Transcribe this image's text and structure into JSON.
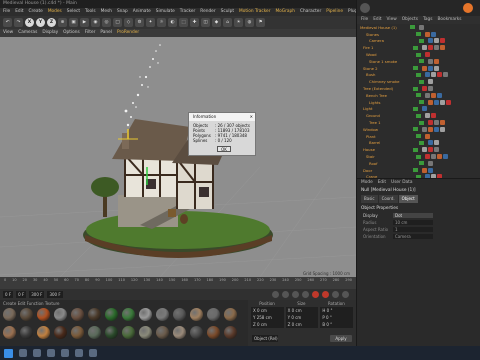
{
  "window": {
    "title": "Medieval House (1).c4d *) - Main"
  },
  "menubar": {
    "items": [
      "File",
      "Edit",
      "Create",
      "Modes",
      "Select",
      "Tools",
      "Mesh",
      "Snap",
      "Animate",
      "Simulate",
      "Tracker",
      "Render",
      "Sculpt",
      "Motion Tracker",
      "MoGraph",
      "Character",
      "Pipeline",
      "Plugins",
      "V-Ray Bridge",
      "Script",
      "Window",
      "Help"
    ],
    "highlighted": [
      "Modes",
      "Motion Tracker",
      "MoGraph",
      "Pipeline",
      "V-Ray Bridge",
      "Window"
    ]
  },
  "toolbar": {
    "buttons": [
      "↶",
      "↷",
      "X",
      "Y",
      "Z",
      "⊕",
      "▣",
      "▶",
      "◉",
      "◎",
      "□",
      "◇",
      "⚙",
      "✦",
      "☼",
      "◐",
      "⬚",
      "✚",
      "◫",
      "◆",
      "⌂",
      "☀",
      "◍",
      "⚑"
    ]
  },
  "viewport": {
    "menu": [
      "View",
      "Cameras",
      "Display",
      "Options",
      "Filter",
      "Panel",
      "ProRender"
    ],
    "selected_item": "ProRender",
    "status": "Grid Spacing : 1000 cm"
  },
  "info_dialog": {
    "title": "Information",
    "rows": [
      {
        "k": "Objects",
        "v": "26 / 307 objects"
      },
      {
        "k": "Points",
        "v": "11893 / 178103"
      },
      {
        "k": "Polygons",
        "v": "9741 / 180348"
      },
      {
        "k": "Splines",
        "v": "0 / 120"
      }
    ],
    "ok_label": "OK"
  },
  "timeline": {
    "ticks": [
      "0",
      "10",
      "20",
      "30",
      "40",
      "50",
      "60",
      "70",
      "80",
      "90",
      "100",
      "110",
      "120",
      "130",
      "140",
      "150",
      "160",
      "170",
      "180",
      "190",
      "200",
      "210",
      "220",
      "230",
      "240",
      "250",
      "260",
      "270",
      "280",
      "290"
    ],
    "start_field": "0 F",
    "current_field": "0 F",
    "end_field": "300 F",
    "end_field2": "300 F"
  },
  "materials": {
    "menu": [
      "Create",
      "Edit",
      "Function",
      "Texture"
    ]
  },
  "coordinates": {
    "headers": [
      "Position",
      "Size",
      "Rotation"
    ],
    "rows": [
      [
        "X 0 cm",
        "X 0 cm",
        "H 0 °"
      ],
      [
        "Y 258 cm",
        "Y 0 cm",
        "P 0 °"
      ],
      [
        "Z 0 cm",
        "Z 0 cm",
        "B 0 °"
      ]
    ],
    "world_label": "Object (Rel)",
    "apply_label": "Apply"
  },
  "object_manager": {
    "menu": [
      "File",
      "Edit",
      "View",
      "Objects",
      "Tags",
      "Bookmarks"
    ],
    "objects": [
      "Medieval House (1)",
      "Stones",
      "Camera",
      "Fire 1",
      "Wood",
      "Stone 1 smoke",
      "Stone 2",
      "Bush",
      "Chimney smoke",
      "Tree (Extended)",
      "Bench Tree",
      "Lights",
      "Light",
      "Ground",
      "Tree 1",
      "Window",
      "Plant",
      "Barrel",
      "House",
      "Stair",
      "Roof",
      "Door",
      "Crane"
    ]
  },
  "attribute_manager": {
    "menu": [
      "Mode",
      "Edit",
      "User Data"
    ],
    "object_name": "Null [Medieval House (1)]",
    "tabs": [
      "Basic",
      "Coord.",
      "Object"
    ],
    "active_tab": "Object",
    "section": "Object Properties",
    "props": [
      {
        "label": "Display",
        "value": "Dot"
      },
      {
        "label": "Radius",
        "value": "10 cm"
      },
      {
        "label": "Aspect Ratio",
        "value": "1"
      },
      {
        "label": "Orientation",
        "value": "Camera"
      }
    ]
  },
  "colors": {
    "accent": "#e6b44a",
    "object_name": "#e6a040",
    "grass": "#4f7a2e",
    "house_white": "#e8e4da",
    "timber": "#3a2a1e",
    "roof": "#6a5a4a"
  }
}
